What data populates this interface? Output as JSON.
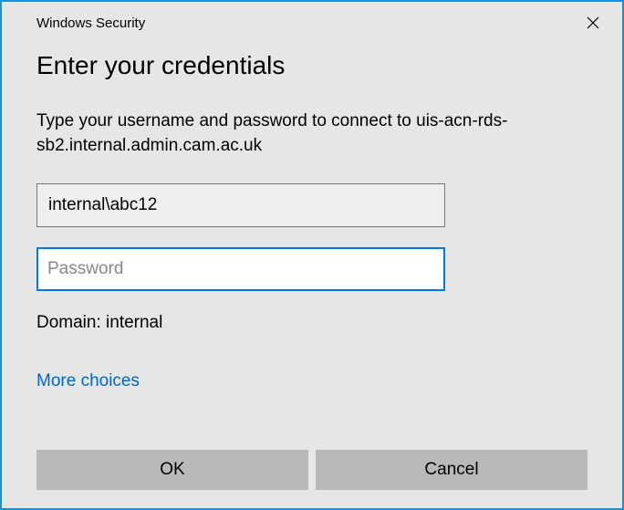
{
  "titlebar": {
    "title": "Windows Security"
  },
  "dialog": {
    "heading": "Enter your credentials",
    "prompt": "Type your username and password to connect to uis-acn-rds-sb2.internal.admin.cam.ac.uk",
    "username_value": "internal\\abc12",
    "password_placeholder": "Password",
    "password_value": "",
    "domain_label": "Domain: internal",
    "more_choices_label": "More choices"
  },
  "buttons": {
    "ok_label": "OK",
    "cancel_label": "Cancel"
  }
}
